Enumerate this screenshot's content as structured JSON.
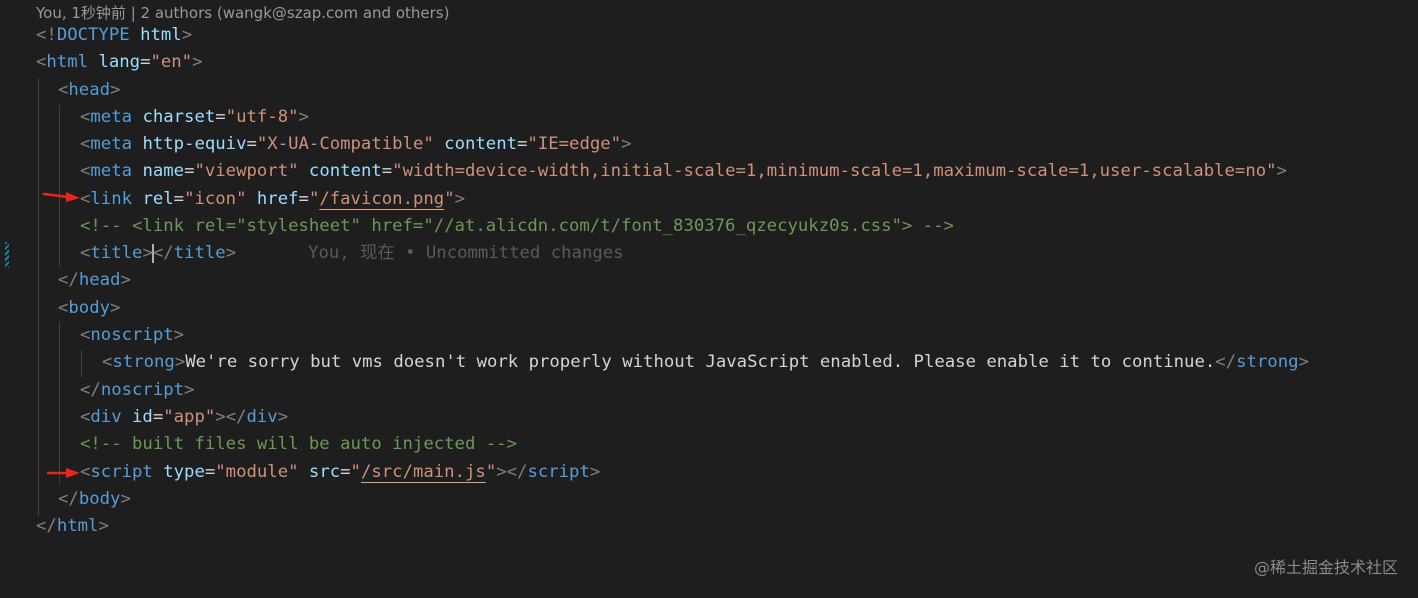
{
  "codelens": "You, 1秒钟前 | 2 authors (wangk@szap.com and others)",
  "blame": "You, 现在 • Uncommitted changes",
  "watermark": "@稀土掘金技术社区",
  "lines": {
    "doctype": {
      "lt": "<!",
      "tag": "DOCTYPE",
      "sp": " ",
      "name": "html",
      "gt": ">"
    },
    "html_open": {
      "lt": "<",
      "tag": "html",
      "attr": "lang",
      "eq": "=",
      "val": "\"en\"",
      "gt": ">"
    },
    "head_open": {
      "lt": "<",
      "tag": "head",
      "gt": ">"
    },
    "meta_charset": {
      "lt": "<",
      "tag": "meta",
      "attr": "charset",
      "eq": "=",
      "val": "\"utf-8\"",
      "gt": ">"
    },
    "meta_http": {
      "lt": "<",
      "tag": "meta",
      "attr1": "http-equiv",
      "val1": "\"X-UA-Compatible\"",
      "attr2": "content",
      "val2": "\"IE=edge\"",
      "gt": ">"
    },
    "meta_viewport": {
      "lt": "<",
      "tag": "meta",
      "attr1": "name",
      "val1": "\"viewport\"",
      "attr2": "content",
      "val2": "\"width=device-width,initial-scale=1,minimum-scale=1,maximum-scale=1,user-scalable=no\"",
      "gt": ">"
    },
    "link": {
      "lt": "<",
      "tag": "link",
      "attr1": "rel",
      "val1": "\"icon\"",
      "attr2": "href",
      "q1": "\"",
      "href": "/favicon.png",
      "q2": "\"",
      "gt": ">"
    },
    "comment_link": "<!-- <link rel=\"stylesheet\" href=\"//at.alicdn.com/t/font_830376_qzecyukz0s.css\"> -->",
    "title": {
      "lt": "<",
      "tag": "title",
      "gt": ">",
      "lt2": "</",
      "tag2": "title",
      "gt2": ">"
    },
    "head_close": {
      "lt": "</",
      "tag": "head",
      "gt": ">"
    },
    "body_open": {
      "lt": "<",
      "tag": "body",
      "gt": ">"
    },
    "noscript_open": {
      "lt": "<",
      "tag": "noscript",
      "gt": ">"
    },
    "strong": {
      "lt": "<",
      "tag": "strong",
      "gt": ">",
      "text": "We're sorry but vms doesn't work properly without JavaScript enabled. Please enable it to continue.",
      "lt2": "</",
      "tag2": "strong",
      "gt2": ">"
    },
    "noscript_close": {
      "lt": "</",
      "tag": "noscript",
      "gt": ">"
    },
    "div_app": {
      "lt": "<",
      "tag": "div",
      "attr": "id",
      "eq": "=",
      "val": "\"app\"",
      "gt": ">",
      "lt2": "</",
      "tag2": "div",
      "gt2": ">"
    },
    "comment_built": "<!-- built files will be auto injected -->",
    "script": {
      "lt": "<",
      "tag": "script",
      "attr1": "type",
      "val1": "\"module\"",
      "attr2": "src",
      "q1": "\"",
      "src": "/src/main.js",
      "q2": "\"",
      "gt": ">",
      "lt2": "</",
      "tag2": "script",
      "gt2": ">"
    },
    "body_close": {
      "lt": "</",
      "tag": "body",
      "gt": ">"
    },
    "html_close": {
      "lt": "</",
      "tag": "html",
      "gt": ">"
    }
  },
  "colors": {
    "background": "#1e1e1e",
    "tag": "#569cd6",
    "attribute": "#9cdcfe",
    "string": "#ce9178",
    "comment": "#6a9955",
    "bracket": "#808080",
    "arrow": "#e8261c"
  },
  "icons": [
    "red-arrow-annotation-icon",
    "git-change-gutter-marker"
  ]
}
